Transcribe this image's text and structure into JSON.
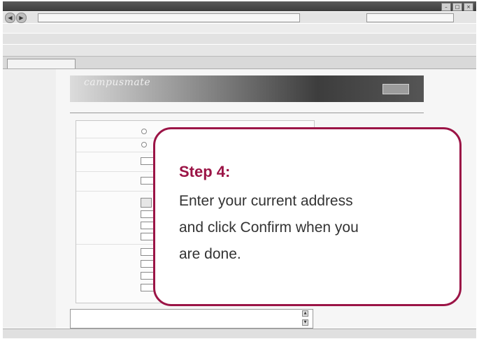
{
  "callout": {
    "step_label": "Step 4:",
    "lines": [
      "Enter your current address",
      "and click Confirm when you",
      "are done."
    ]
  },
  "site": {
    "logo": "campusmate"
  },
  "colors": {
    "callout_border": "#9b1446",
    "callout_text": "#333333"
  },
  "icons": {
    "back": "back-arrow-icon",
    "forward": "forward-arrow-icon"
  }
}
